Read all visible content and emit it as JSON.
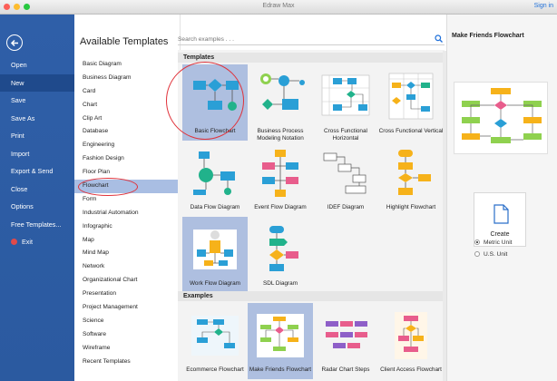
{
  "window": {
    "title": "Edraw Max",
    "signin": "Sign in"
  },
  "colors": {
    "sidebar": "#2f5fa8",
    "selection": "#a9bee3",
    "annotation": "#e0323a"
  },
  "left_menu": {
    "items": [
      {
        "label": "Open"
      },
      {
        "label": "New",
        "active": true
      },
      {
        "label": "Save"
      },
      {
        "label": "Save As"
      },
      {
        "label": "Print"
      },
      {
        "label": "Import"
      },
      {
        "label": "Export & Send"
      },
      {
        "label": "Close"
      },
      {
        "label": "Options"
      },
      {
        "label": "Free Templates..."
      },
      {
        "label": "Exit"
      }
    ]
  },
  "categories": {
    "heading": "Available Templates",
    "items": [
      "Basic Diagram",
      "Business Diagram",
      "Card",
      "Chart",
      "Clip Art",
      "Database",
      "Engineering",
      "Fashion Design",
      "Floor Plan",
      "Flowchart",
      "Form",
      "Industrial Automation",
      "Infographic",
      "Map",
      "Mind Map",
      "Network",
      "Organizational Chart",
      "Presentation",
      "Project Management",
      "Science",
      "Software",
      "Wireframe",
      "Recent Templates"
    ],
    "selected": "Flowchart"
  },
  "search": {
    "placeholder": "Search examples . . ."
  },
  "templates": {
    "heading": "Templates",
    "items": [
      {
        "label": "Basic Flowchart",
        "icon": "basic-flowchart-thumb",
        "selected": true
      },
      {
        "label": "Business Process Modeling Notation",
        "icon": "bpmn-thumb"
      },
      {
        "label": "Cross Functional Horizontal",
        "icon": "cross-functional-horizontal-thumb"
      },
      {
        "label": "Cross Functional Vertical",
        "icon": "cross-functional-vertical-thumb"
      },
      {
        "label": "Data Flow Diagram",
        "icon": "data-flow-thumb"
      },
      {
        "label": "Event Flow Diagram",
        "icon": "event-flow-thumb"
      },
      {
        "label": "IDEF Diagram",
        "icon": "idef-thumb"
      },
      {
        "label": "Highlight Flowchart",
        "icon": "highlight-flowchart-thumb"
      },
      {
        "label": "Work Flow Diagram",
        "icon": "work-flow-thumb",
        "highlighted": true
      },
      {
        "label": "SDL Diagram",
        "icon": "sdl-thumb"
      }
    ]
  },
  "examples": {
    "heading": "Examples",
    "items": [
      {
        "label": "Ecommerce Flowchart"
      },
      {
        "label": "Make Friends Flowchart",
        "highlighted": true
      },
      {
        "label": "Radar Chart Steps"
      },
      {
        "label": "Client Access Flowchart"
      }
    ]
  },
  "preview": {
    "title": "Make Friends Flowchart",
    "create_label": "Create",
    "units": [
      {
        "label": "Metric Unit",
        "checked": true
      },
      {
        "label": "U.S. Unit",
        "checked": false
      }
    ]
  }
}
